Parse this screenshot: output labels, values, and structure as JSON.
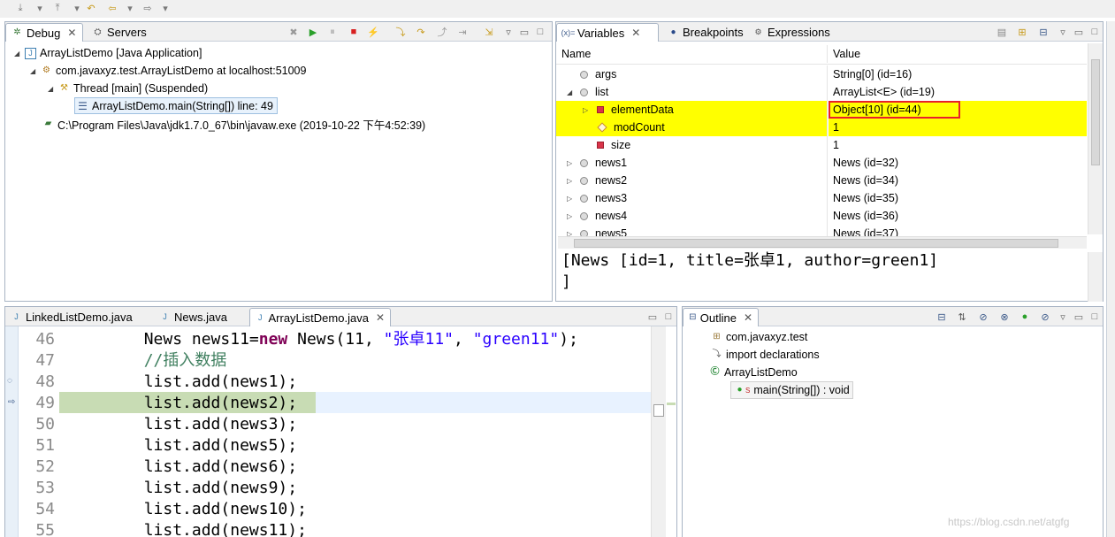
{
  "colors": {
    "accent": "#3c7fb1",
    "highlight": "#ffff00",
    "current_line": "#c8dcb4",
    "keyword": "#7f0055",
    "string": "#2a00ff",
    "comment": "#3f7f5f",
    "red_box": "#e8202a"
  },
  "top_toolbar": {
    "icons": [
      "step-filter-icon",
      "drop-to-frame-icon",
      "back-icon",
      "forward-icon"
    ]
  },
  "debug_view": {
    "tabs": [
      {
        "label": "Debug",
        "close": "✕",
        "icon": "debug-icon"
      },
      {
        "label": "Servers",
        "icon": "servers-icon"
      }
    ],
    "toolbar_icons": [
      "remove-terminated-icon",
      "resume-icon",
      "suspend-icon",
      "terminate-icon",
      "disconnect-icon",
      "step-into-icon",
      "step-over-icon",
      "step-return-icon",
      "drop-frame-icon",
      "view-menu-icon",
      "minimize-icon",
      "maximize-icon"
    ],
    "tree": [
      {
        "label": "ArrayListDemo [Java Application]",
        "indent": 0
      },
      {
        "label": "com.javaxyz.test.ArrayListDemo at localhost:51009",
        "indent": 1
      },
      {
        "label": "Thread [main] (Suspended)",
        "indent": 2
      },
      {
        "label": "ArrayListDemo.main(String[]) line: 49",
        "indent": 3
      },
      {
        "label": "C:\\Program Files\\Java\\jdk1.7.0_67\\bin\\javaw.exe (2019-10-22 下午4:52:39)",
        "indent": 1
      }
    ]
  },
  "variables_view": {
    "tabs": [
      {
        "label": "Variables",
        "close": "✕"
      },
      {
        "label": "Breakpoints"
      },
      {
        "label": "Expressions"
      }
    ],
    "columns": {
      "name": "Name",
      "value": "Value"
    },
    "rows": [
      {
        "name": "args",
        "value": "String[0]  (id=16)"
      },
      {
        "name": "list",
        "value": "ArrayList<E>  (id=19)"
      },
      {
        "name": "elementData",
        "value": "Object[10]  (id=44)"
      },
      {
        "name": "modCount",
        "value": "1"
      },
      {
        "name": "size",
        "value": "1"
      },
      {
        "name": "news1",
        "value": "News  (id=32)"
      },
      {
        "name": "news2",
        "value": "News  (id=34)"
      },
      {
        "name": "news3",
        "value": "News  (id=35)"
      },
      {
        "name": "news4",
        "value": "News  (id=36)"
      },
      {
        "name": "news5",
        "value": "News  (id=37)"
      }
    ],
    "detail_line1": "[News [id=1, title=张卓1, author=green1]",
    "detail_line2": "]"
  },
  "editor": {
    "tabs": [
      {
        "label": "LinkedListDemo.java"
      },
      {
        "label": "News.java"
      },
      {
        "label": "ArrayListDemo.java",
        "close": "✕"
      }
    ],
    "lines": [
      {
        "num": "46",
        "indent": "        ",
        "parts": [
          {
            "t": "News news11="
          },
          {
            "t": "new",
            "c": "kw"
          },
          {
            "t": " News(11, "
          },
          {
            "t": "\"张卓11\"",
            "c": "str"
          },
          {
            "t": ", "
          },
          {
            "t": "\"green11\"",
            "c": "str"
          },
          {
            "t": ");"
          }
        ]
      },
      {
        "num": "47",
        "indent": "        ",
        "parts": [
          {
            "t": "//插入数据",
            "c": "cmt"
          }
        ]
      },
      {
        "num": "48",
        "indent": "        ",
        "parts": [
          {
            "t": "list.add(news1);"
          }
        ]
      },
      {
        "num": "49",
        "indent": "        ",
        "parts": [
          {
            "t": "list.add(news2);"
          }
        ]
      },
      {
        "num": "50",
        "indent": "        ",
        "parts": [
          {
            "t": "list.add(news3);"
          }
        ]
      },
      {
        "num": "51",
        "indent": "        ",
        "parts": [
          {
            "t": "list.add(news5);"
          }
        ]
      },
      {
        "num": "52",
        "indent": "        ",
        "parts": [
          {
            "t": "list.add(news6);"
          }
        ]
      },
      {
        "num": "53",
        "indent": "        ",
        "parts": [
          {
            "t": "list.add(news9);"
          }
        ]
      },
      {
        "num": "54",
        "indent": "        ",
        "parts": [
          {
            "t": "list.add(news10);"
          }
        ]
      },
      {
        "num": "55",
        "indent": "        ",
        "parts": [
          {
            "t": "list.add(news11);"
          }
        ]
      }
    ]
  },
  "outline": {
    "tab": {
      "label": "Outline",
      "close": "✕"
    },
    "items": [
      {
        "label": "com.javaxyz.test"
      },
      {
        "label": "import declarations"
      },
      {
        "label": "ArrayListDemo"
      },
      {
        "label": "main(String[]) : void",
        "modifier": "S"
      }
    ]
  },
  "watermark": "https://blog.csdn.net/atgfg"
}
